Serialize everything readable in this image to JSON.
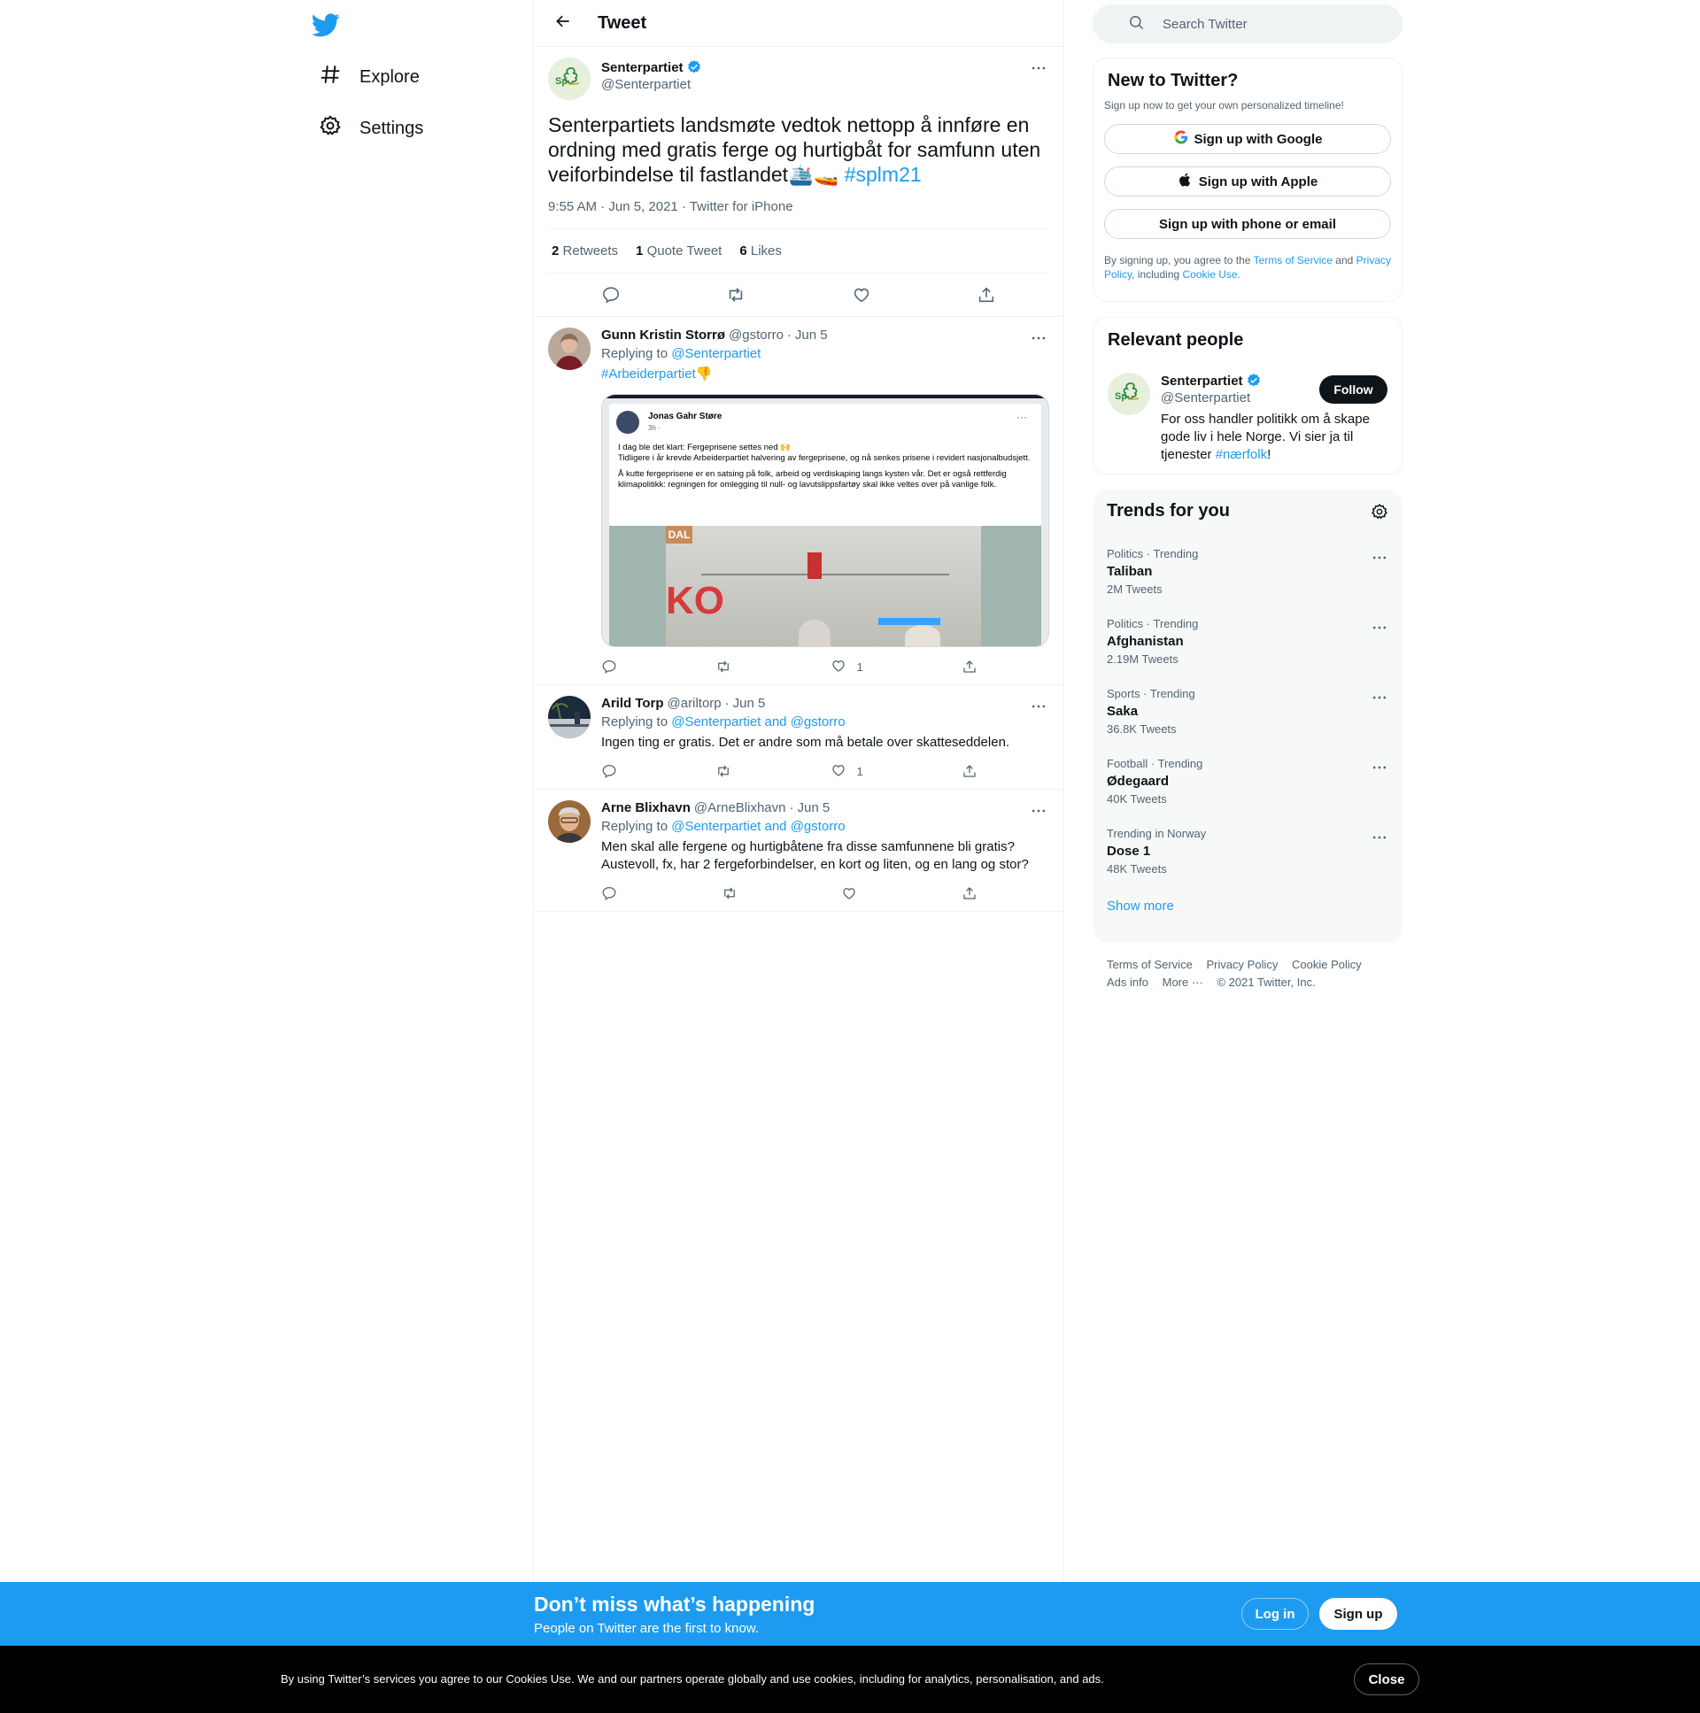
{
  "nav": {
    "items": [
      {
        "label": "Explore",
        "icon": "hashtag-icon"
      },
      {
        "label": "Settings",
        "icon": "gear-icon"
      }
    ]
  },
  "header": {
    "title": "Tweet"
  },
  "focal": {
    "name": "Senterpartiet",
    "handle": "@Senterpartiet",
    "text": "Senterpartiets landsmøte vedtok nettopp å innføre en ordning med gratis ferge og hurtigbåt for samfunn uten veiforbindelse til fastlandet🛳️🚤",
    "hashtag": "#splm21",
    "meta": "9:55 AM · Jun 5, 2021 · Twitter for iPhone",
    "stats": [
      {
        "count": "2",
        "label": "Retweets"
      },
      {
        "count": "1",
        "label": "Quote Tweet"
      },
      {
        "count": "6",
        "label": "Likes"
      }
    ]
  },
  "replies": [
    {
      "name": "Gunn Kristin Storrø",
      "handle": "@gstorro",
      "date": "Jun 5",
      "replying_prefix": "Replying to",
      "replying_to": "@Senterpartiet",
      "text_link": "#Arbeiderpartiet",
      "text": "👎",
      "likes": "1",
      "embedded": {
        "author": "Jonas Gahr Støre",
        "time": "3h · ",
        "line1": "I dag ble det klart: Fergeprisene settes ned 🙌",
        "line2": "Tidligere i år krevde Arbeiderpartiet halvering av fergeprisene, og nå senkes prisene i revidert nasjonalbudsjett.",
        "line3": "Å kutte fergeprisene er en satsing på folk, arbeid og verdiskaping langs kysten vår. Det er også rettferdig klimapolitikk: regningen for omlegging til null- og lavutslippsfartøy skal ikke veltes over på vanlige folk.",
        "sign1": "DAL",
        "sign2": "KO"
      }
    },
    {
      "name": "Arild Torp",
      "handle": "@ariltorp",
      "date": "Jun 5",
      "replying_prefix": "Replying to",
      "replying_to": "@Senterpartiet and @gstorro",
      "text": "Ingen ting er gratis. Det er andre som må betale over skatteseddelen.",
      "likes": "1"
    },
    {
      "name": "Arne Blixhavn",
      "handle": "@ArneBlixhavn",
      "date": "Jun 5",
      "replying_prefix": "Replying to",
      "replying_to": "@Senterpartiet and @gstorro",
      "text_line1": "Men skal alle fergene og hurtigbåtene fra disse samfunnene bli gratis?",
      "text_line2": "Austevoll, fx, har 2 fergeforbindelser, en kort og liten, og en lang og stor?"
    }
  ],
  "search": {
    "placeholder": "Search Twitter"
  },
  "new_to_twitter": {
    "title": "New to Twitter?",
    "subtitle": "Sign up now to get your own personalized timeline!",
    "google": "Sign up with Google",
    "apple": "Sign up with Apple",
    "phone": "Sign up with phone or email",
    "legal_1": "By signing up, you agree to the",
    "tos": "Terms of Service",
    "and": "and",
    "privacy": "Privacy Policy",
    "including": ", including",
    "cookie": "Cookie Use."
  },
  "relevant": {
    "title": "Relevant people",
    "name": "Senterpartiet",
    "handle": "@Senterpartiet",
    "follow": "Follow",
    "bio": "For oss handler politikk om å skape gode liv i hele Norge. Vi sier ja til tjenester",
    "bio_tag": "#nærfolk",
    "bio_end": "!"
  },
  "trends": {
    "title": "Trends for you",
    "items": [
      {
        "context": "Politics · Trending",
        "name": "Taliban",
        "count": "2M Tweets"
      },
      {
        "context": "Politics · Trending",
        "name": "Afghanistan",
        "count": "2.19M Tweets"
      },
      {
        "context": "Sports · Trending",
        "name": "Saka",
        "count": "36.8K Tweets"
      },
      {
        "context": "Football · Trending",
        "name": "Ødegaard",
        "count": "40K Tweets"
      },
      {
        "context": "Trending in Norway",
        "name": "Dose 1",
        "count": "48K Tweets"
      }
    ],
    "show_more": "Show more"
  },
  "footer": {
    "links": [
      "Terms of Service",
      "Privacy Policy",
      "Cookie Policy"
    ],
    "links2": [
      "Ads info",
      "More ···",
      "© 2021 Twitter, Inc."
    ]
  },
  "bottom_bar": {
    "title": "Don’t miss what’s happening",
    "subtitle": "People on Twitter are the first to know.",
    "login": "Log in",
    "signup": "Sign up"
  },
  "cookie_bar": {
    "text": "By using Twitter’s services you agree to our Cookies Use. We and our partners operate globally and use cookies, including for analytics, personalisation, and ads.",
    "close": "Close"
  },
  "colors": {
    "accent": "#1d9bf0",
    "text": "#0f1419",
    "muted": "#536471"
  }
}
